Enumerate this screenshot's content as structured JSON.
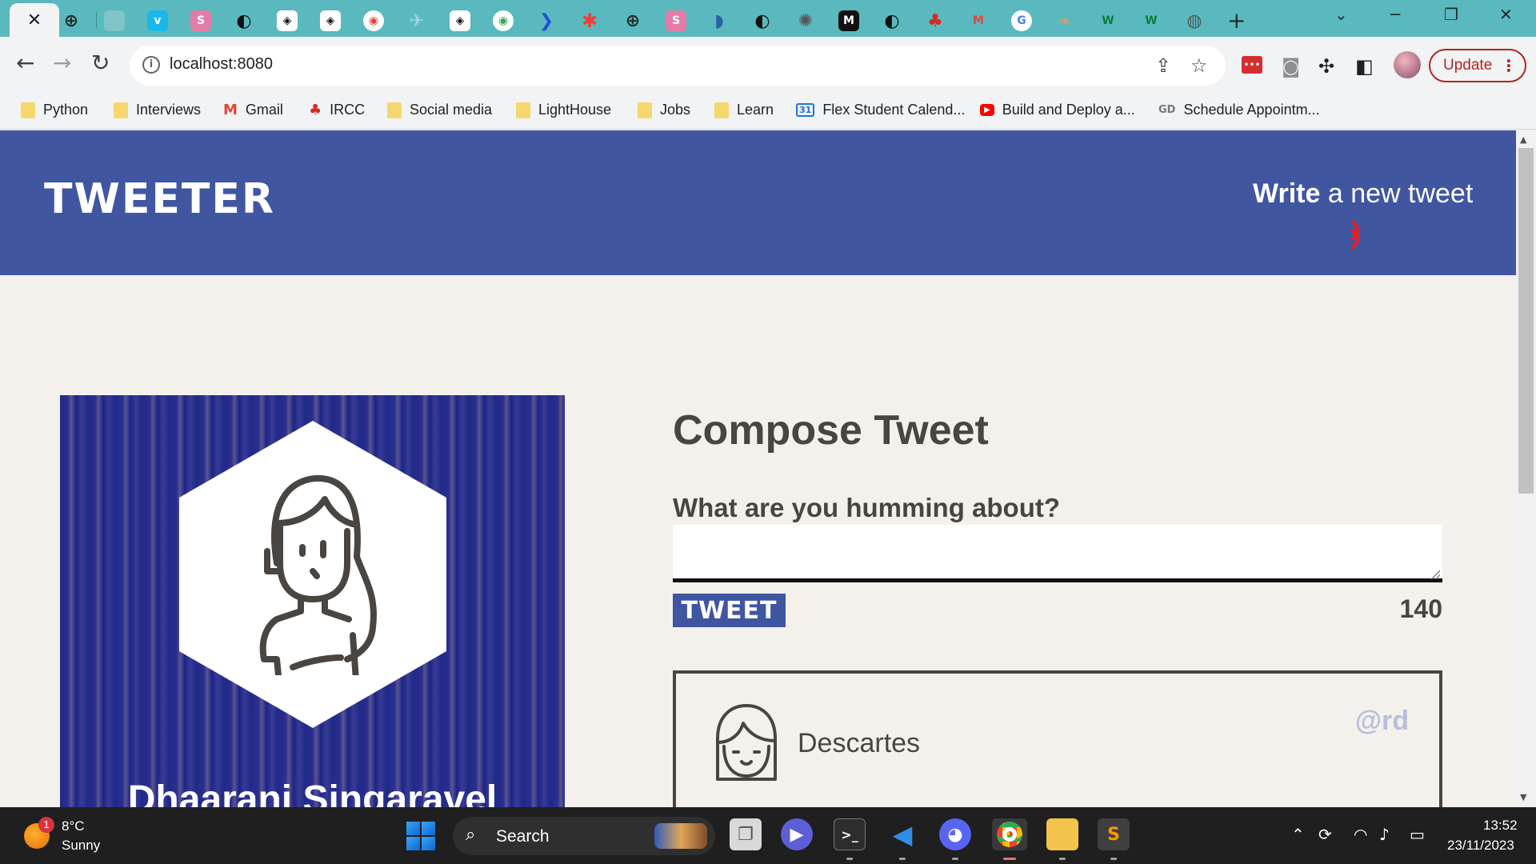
{
  "browser": {
    "tab_close_glyph": "✕",
    "new_tab_glyph": "+",
    "window_controls": {
      "chevron": "⌄",
      "minimize": "─",
      "restore": "❐",
      "close": "✕"
    },
    "url": "localhost:8080",
    "update_label": "Update",
    "bookmarks": [
      {
        "label": "Python",
        "icon": "folder-icon"
      },
      {
        "label": "Interviews",
        "icon": "folder-icon"
      },
      {
        "label": "Gmail",
        "icon": "gmail-icon"
      },
      {
        "label": "IRCC",
        "icon": "maple-leaf-icon"
      },
      {
        "label": "Social media",
        "icon": "folder-icon"
      },
      {
        "label": "LightHouse",
        "icon": "folder-icon"
      },
      {
        "label": "Jobs",
        "icon": "folder-icon"
      },
      {
        "label": "Learn",
        "icon": "folder-icon"
      },
      {
        "label": "Flex Student Calend...",
        "icon": "calendar-icon"
      },
      {
        "label": "Build and Deploy a...",
        "icon": "youtube-icon"
      },
      {
        "label": "Schedule Appointm...",
        "icon": "gd-icon"
      }
    ]
  },
  "app": {
    "brand": "TWEETER",
    "write_bold": "Write",
    "write_rest": " a new tweet",
    "profile_name": "Dhaarani Singaravel",
    "compose_title": "Compose Tweet",
    "compose_label": "What are you humming about?",
    "tweet_button": "TWEET",
    "counter": "140",
    "tweet": {
      "name": "Descartes",
      "handle": "@rd"
    },
    "colors": {
      "nav": "#4056a1",
      "text": "#4a4540",
      "accent_chevron": "#e0202a",
      "handle": "#b8bde0"
    }
  },
  "taskbar": {
    "weather_badge": "1",
    "temperature": "8°C",
    "condition": "Sunny",
    "search_label": "Search",
    "time": "13:52",
    "date": "23/11/2023"
  }
}
